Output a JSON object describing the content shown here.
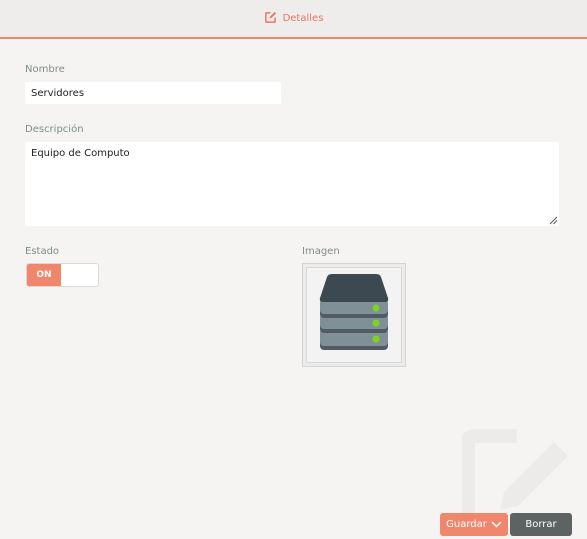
{
  "header": {
    "tab_label": "Detalles",
    "tab_icon": "edit-icon",
    "accent": "#f0876d"
  },
  "form": {
    "name_label": "Nombre",
    "name_value": "Servidores",
    "description_label": "Descripción",
    "description_value": "Equipo de Computo",
    "status_label": "Estado",
    "status_toggle": "ON",
    "image_label": "Imagen",
    "image_icon": "server-icon"
  },
  "actions": {
    "save_label": "Guardar",
    "delete_label": "Borrar",
    "save_color": "#f0876d",
    "delete_color": "#5d6263"
  }
}
